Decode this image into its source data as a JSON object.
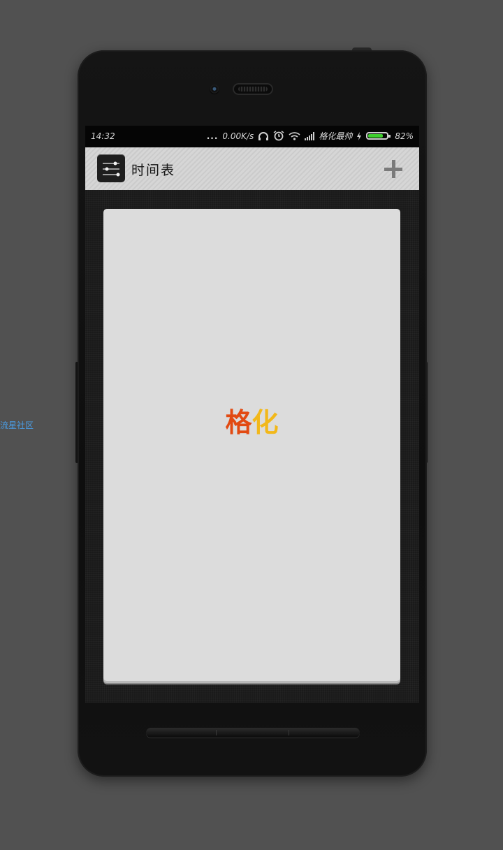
{
  "side_link": "流星社区",
  "statusbar": {
    "time": "14:32",
    "more": "...",
    "net_speed": "0.00K/s",
    "carrier": "格化最帅",
    "battery_percent": "82%",
    "battery_level": 0.82,
    "icons": [
      "headphones-icon",
      "alarm-icon",
      "wifi-icon",
      "signal-icon",
      "charging-icon",
      "battery-icon"
    ]
  },
  "appbar": {
    "title": "时间表",
    "logo_icon": "timeline-icon",
    "add_icon": "plus-icon"
  },
  "card": {
    "text_part1": "格",
    "text_part2": "化",
    "colors": {
      "part1": "#e24a12",
      "part2": "#f2b81a"
    }
  },
  "nav": {
    "icons": [
      "back-icon",
      "home-icon",
      "menu-icon"
    ]
  }
}
